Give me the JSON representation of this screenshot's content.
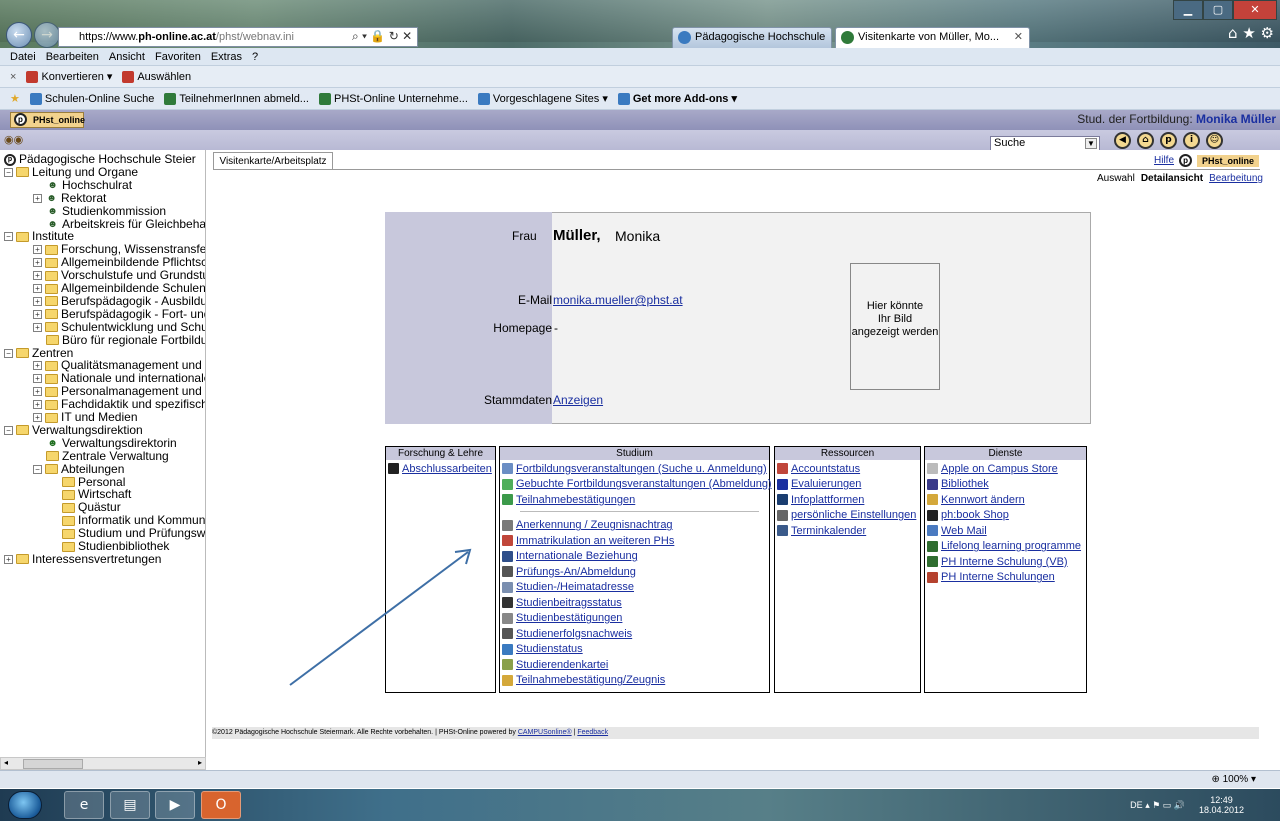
{
  "browser": {
    "url_prefix": "https://www.",
    "url_domain": "ph-online.ac.at",
    "url_path": "/phst/webnav.ini",
    "tabs": [
      {
        "label": "Pädagogische Hochschule Stei..."
      },
      {
        "label": "Visitenkarte von Müller, Mo..."
      }
    ],
    "menu": [
      "Datei",
      "Bearbeiten",
      "Ansicht",
      "Favoriten",
      "Extras",
      "?"
    ],
    "convert": {
      "close": "×",
      "convert_label": "Konvertieren",
      "select_label": "Auswählen"
    },
    "favorites": [
      "Schulen-Online Suche",
      "TeilnehmerInnen abmeld...",
      "PHSt-Online Unternehme...",
      "Vorgeschlagene Sites ▾",
      "Get more Add-ons ▾"
    ],
    "zoom": "100%"
  },
  "app": {
    "tab_label": "PHst_online",
    "user_role": "Stud. der Fortbildung: ",
    "user_name": "Monika Müller",
    "search_label": "Suche"
  },
  "tree": [
    {
      "label": "Pädagogische Hochschule Steier",
      "level": 0,
      "icon": "logo"
    },
    {
      "label": "Leitung und Organe",
      "level": 0,
      "icon": "folder",
      "toggle": "−"
    },
    {
      "label": "Hochschulrat",
      "level": 1,
      "icon": "people"
    },
    {
      "label": "Rektorat",
      "level": 1,
      "icon": "people",
      "toggle": "+"
    },
    {
      "label": "Studienkommission",
      "level": 1,
      "icon": "people"
    },
    {
      "label": "Arbeitskreis für Gleichbeha",
      "level": 1,
      "icon": "people"
    },
    {
      "label": "Institute",
      "level": 0,
      "icon": "folder",
      "toggle": "−"
    },
    {
      "label": "Forschung, Wissenstransfe",
      "level": 1,
      "icon": "folder",
      "toggle": "+"
    },
    {
      "label": "Allgemeinbildende Pflichtsc",
      "level": 1,
      "icon": "folder",
      "toggle": "+"
    },
    {
      "label": "Vorschulstufe und Grundstu",
      "level": 1,
      "icon": "folder",
      "toggle": "+"
    },
    {
      "label": "Allgemeinbildende Schulen",
      "level": 1,
      "icon": "folder",
      "toggle": "+"
    },
    {
      "label": "Berufspädagogik - Ausbildu",
      "level": 1,
      "icon": "folder",
      "toggle": "+"
    },
    {
      "label": "Berufspädagogik - Fort- und",
      "level": 1,
      "icon": "folder",
      "toggle": "+"
    },
    {
      "label": "Schulentwicklung und Schu",
      "level": 1,
      "icon": "folder",
      "toggle": "+"
    },
    {
      "label": "Büro für regionale Fortbildu",
      "level": 1,
      "icon": "folder"
    },
    {
      "label": "Zentren",
      "level": 0,
      "icon": "folder",
      "toggle": "−"
    },
    {
      "label": "Qualitätsmanagement und",
      "level": 1,
      "icon": "folder",
      "toggle": "+"
    },
    {
      "label": "Nationale und internationale",
      "level": 1,
      "icon": "folder",
      "toggle": "+"
    },
    {
      "label": "Personalmanagement und",
      "level": 1,
      "icon": "folder",
      "toggle": "+"
    },
    {
      "label": "Fachdidaktik und spezifisch",
      "level": 1,
      "icon": "folder",
      "toggle": "+"
    },
    {
      "label": "IT und Medien",
      "level": 1,
      "icon": "folder",
      "toggle": "+"
    },
    {
      "label": "Verwaltungsdirektion",
      "level": 0,
      "icon": "folder",
      "toggle": "−"
    },
    {
      "label": "Verwaltungsdirektorin",
      "level": 1,
      "icon": "person"
    },
    {
      "label": "Zentrale Verwaltung",
      "level": 1,
      "icon": "folder"
    },
    {
      "label": "Abteilungen",
      "level": 1,
      "icon": "folder",
      "toggle": "−"
    },
    {
      "label": "Personal",
      "level": 2,
      "icon": "folder"
    },
    {
      "label": "Wirtschaft",
      "level": 2,
      "icon": "folder"
    },
    {
      "label": "Quästur",
      "level": 2,
      "icon": "folder"
    },
    {
      "label": "Informatik und Kommun",
      "level": 2,
      "icon": "folder"
    },
    {
      "label": "Studium und Prüfungsw",
      "level": 2,
      "icon": "folder"
    },
    {
      "label": "Studienbibliothek",
      "level": 2,
      "icon": "folder"
    },
    {
      "label": "Interessensvertretungen",
      "level": 0,
      "icon": "folder",
      "toggle": "+"
    }
  ],
  "content": {
    "tab_label": "Visitenkarte/Arbeitsplatz",
    "help_label": "Hilfe",
    "brand_label": "PHst_online",
    "view_auswahl": "Auswahl",
    "view_detail": "Detailansicht",
    "view_edit": "Bearbeitung"
  },
  "card": {
    "salutation": "Frau",
    "surname": "Müller,",
    "firstname": "Monika",
    "email_label": "E-Mail",
    "email": "monika.mueller@phst.at",
    "homepage_label": "Homepage",
    "homepage": "-",
    "stammdaten_label": "Stammdaten",
    "stammdaten_link": "Anzeigen",
    "picture_text_1": "Hier könnte",
    "picture_text_2": "Ihr Bild",
    "picture_text_3": "angezeigt werden"
  },
  "boxes": {
    "forschung": {
      "title": "Forschung & Lehre",
      "items": [
        {
          "label": "Abschlussarbeiten",
          "icon": "graduation-cap-icon",
          "color": "#222222"
        }
      ]
    },
    "studium": {
      "title": "Studium",
      "items": [
        {
          "label": "Fortbildungsveranstaltungen (Suche u. Anmeldung)",
          "icon": "calendar-search-icon",
          "color": "#6b8ec4"
        },
        {
          "label": "Gebuchte Fortbildungsveranstaltungen (Abmeldung)",
          "icon": "checkmark-icon",
          "color": "#4fae5a"
        },
        {
          "label": "Teilnahmebestätigungen",
          "icon": "certificate-icon",
          "color": "#3c9a4a"
        }
      ],
      "items2": [
        {
          "label": "Anerkennung / Zeugnisnachtrag",
          "icon": "document-icon",
          "color": "#7a7a7a"
        },
        {
          "label": "Immatrikulation an weiteren PHs",
          "icon": "id-card-icon",
          "color": "#c0463a"
        },
        {
          "label": "Internationale Beziehung",
          "icon": "globe-icon",
          "color": "#2f4f8a"
        },
        {
          "label": "Prüfungs-An/Abmeldung",
          "icon": "exam-list-icon",
          "color": "#555555"
        },
        {
          "label": "Studien-/Heimatadresse",
          "icon": "address-icon",
          "color": "#7b8fb0"
        },
        {
          "label": "Studienbeitragsstatus",
          "icon": "euro-icon",
          "color": "#333333"
        },
        {
          "label": "Studienbestätigungen",
          "icon": "confirmation-icon",
          "color": "#888888"
        },
        {
          "label": "Studienerfolgsnachweis",
          "icon": "report-icon",
          "color": "#555555"
        },
        {
          "label": "Studienstatus",
          "icon": "status-icon",
          "color": "#3a7ac0"
        },
        {
          "label": "Studierendenkartei",
          "icon": "card-index-icon",
          "color": "#8aa04a"
        },
        {
          "label": "Teilnahmebestätigung/Zeugnis",
          "icon": "puzzle-icon",
          "color": "#d4a83a"
        }
      ]
    },
    "ressourcen": {
      "title": "Ressourcen",
      "items": [
        {
          "label": "Accountstatus",
          "icon": "account-icon",
          "color": "#c0463a"
        },
        {
          "label": "Evaluierungen",
          "icon": "question-icon",
          "color": "#1a2fa0"
        },
        {
          "label": "Infoplattformen",
          "icon": "info-icon",
          "color": "#1a3d70"
        },
        {
          "label": "persönliche Einstellungen",
          "icon": "settings-icon",
          "color": "#666666"
        },
        {
          "label": "Terminkalender",
          "icon": "calendar-icon",
          "color": "#3a5a8a"
        }
      ]
    },
    "dienste": {
      "title": "Dienste",
      "items": [
        {
          "label": "Apple on Campus Store",
          "icon": "store-icon",
          "color": "#bbbbbb"
        },
        {
          "label": "Bibliothek",
          "icon": "library-icon",
          "color": "#3a3a8a"
        },
        {
          "label": "Kennwort ändern",
          "icon": "key-icon",
          "color": "#d4a83a"
        },
        {
          "label": "ph:book Shop",
          "icon": "book-icon",
          "color": "#222222"
        },
        {
          "label": "Web Mail",
          "icon": "mail-icon",
          "color": "#4a7ac0"
        },
        {
          "label": "Lifelong learning programme",
          "icon": "people-icon",
          "color": "#2f6d2f"
        },
        {
          "label": "PH Interne Schulung (VB)",
          "icon": "people-icon",
          "color": "#2f6d2f"
        },
        {
          "label": "PH Interne Schulungen",
          "icon": "training-icon",
          "color": "#b5422e"
        }
      ]
    }
  },
  "footer": {
    "text": "©2012 Pädagogische Hochschule Steiermark. Alle Rechte vorbehalten. | PHSt-Online powered by ",
    "campus_link": "CAMPUSonline®",
    "sep": " | ",
    "feedback_link": "Feedback"
  },
  "taskbar": {
    "lang": "DE",
    "time": "12:49",
    "date": "18.04.2012"
  }
}
